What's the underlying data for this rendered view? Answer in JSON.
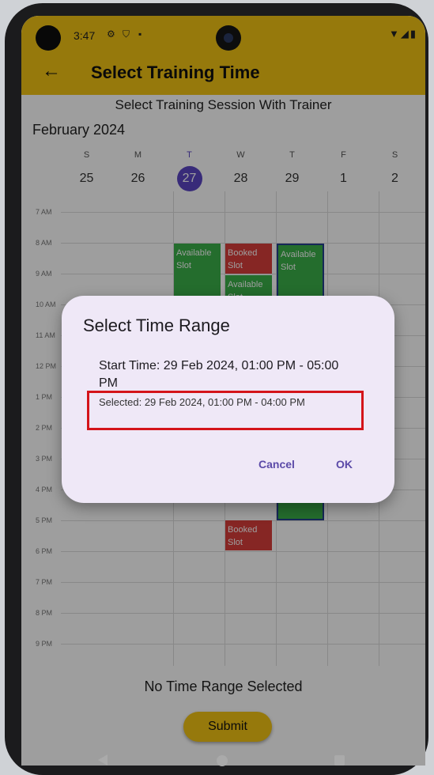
{
  "status_bar": {
    "time": "3:47",
    "left_icons": [
      "gear-icon",
      "shield-icon",
      "sim-card-icon"
    ],
    "right_icons": [
      "wifi-icon",
      "signal-icon",
      "battery-icon"
    ]
  },
  "app_bar": {
    "title": "Select Training Time",
    "back_icon": "arrow-left-icon"
  },
  "subtitle": "Select Training Session With Trainer",
  "calendar": {
    "month": "February 2024",
    "days": [
      {
        "name": "S",
        "date": "25"
      },
      {
        "name": "M",
        "date": "26"
      },
      {
        "name": "T",
        "date": "27",
        "today": true
      },
      {
        "name": "W",
        "date": "28"
      },
      {
        "name": "T",
        "date": "29"
      },
      {
        "name": "F",
        "date": "1"
      },
      {
        "name": "S",
        "date": "2"
      }
    ],
    "hours": [
      "7 AM",
      "8 AM",
      "9 AM",
      "10 AM",
      "11 AM",
      "12 PM",
      "1 PM",
      "2 PM",
      "3 PM",
      "4 PM",
      "5 PM",
      "6 PM",
      "7 PM",
      "8 PM",
      "9 PM"
    ],
    "slots": {
      "available_1": "Available Slot",
      "booked_1": "Booked Slot",
      "available_2": "Available Slot",
      "available_3": "Available Slot",
      "booked_2": "Booked Slot"
    }
  },
  "dialog": {
    "title": "Select Time Range",
    "start_time": "Start Time: 29 Feb 2024, 01:00 PM - 05:00 PM",
    "selected": "Selected: 29 Feb 2024, 01:00 PM - 04:00 PM",
    "cancel_label": "Cancel",
    "ok_label": "OK"
  },
  "status_message": "No Time Range Selected",
  "submit_label": "Submit",
  "colors": {
    "app_bar": "#f2c314",
    "today_circle": "#5b46c4",
    "available_slot": "#3bb04a",
    "booked_slot": "#d93e3a",
    "dialog_bg": "#efe8f7",
    "highlight_box": "#d4141a"
  }
}
